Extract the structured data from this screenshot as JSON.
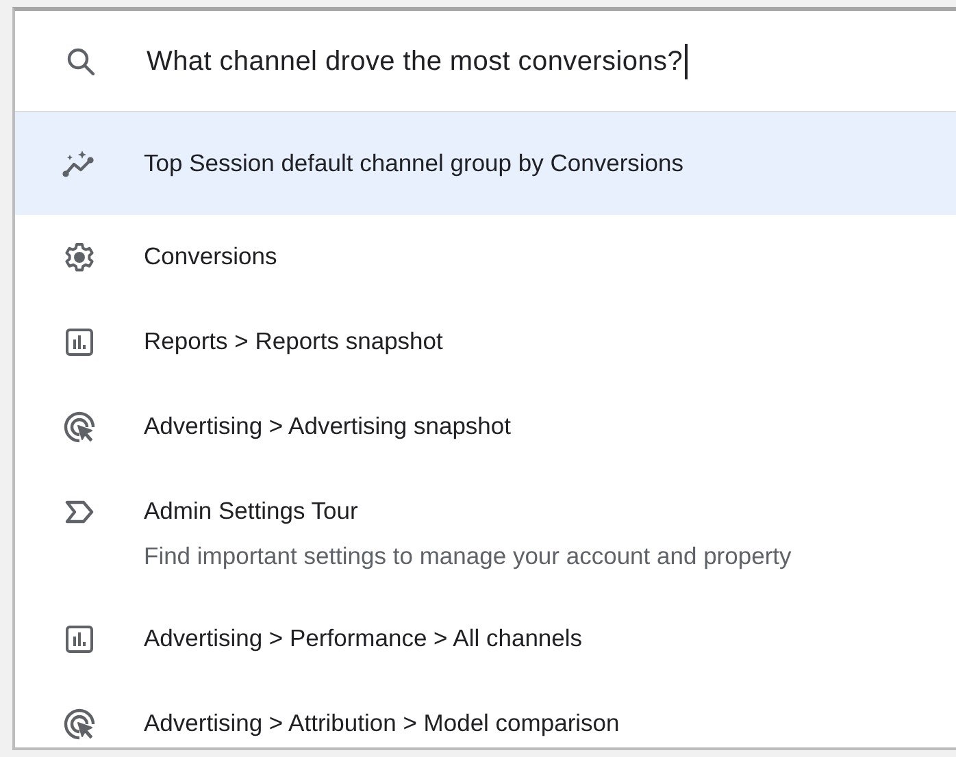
{
  "search": {
    "value": "What channel drove the most conversions?"
  },
  "results": [
    {
      "kind": "insight",
      "label": "Top Session default channel group by Conversions",
      "selected": true
    },
    {
      "kind": "setting",
      "label": "Conversions",
      "selected": false
    },
    {
      "kind": "report",
      "label": "Reports > Reports snapshot",
      "selected": false
    },
    {
      "kind": "advertising",
      "label": "Advertising > Advertising snapshot",
      "selected": false
    },
    {
      "kind": "tour",
      "label": "Admin Settings Tour",
      "description": "Find important settings to manage your account and property",
      "selected": false
    },
    {
      "kind": "report",
      "label": "Advertising > Performance > All channels",
      "selected": false
    },
    {
      "kind": "advertising",
      "label": "Advertising > Attribution > Model comparison",
      "selected": false
    }
  ]
}
